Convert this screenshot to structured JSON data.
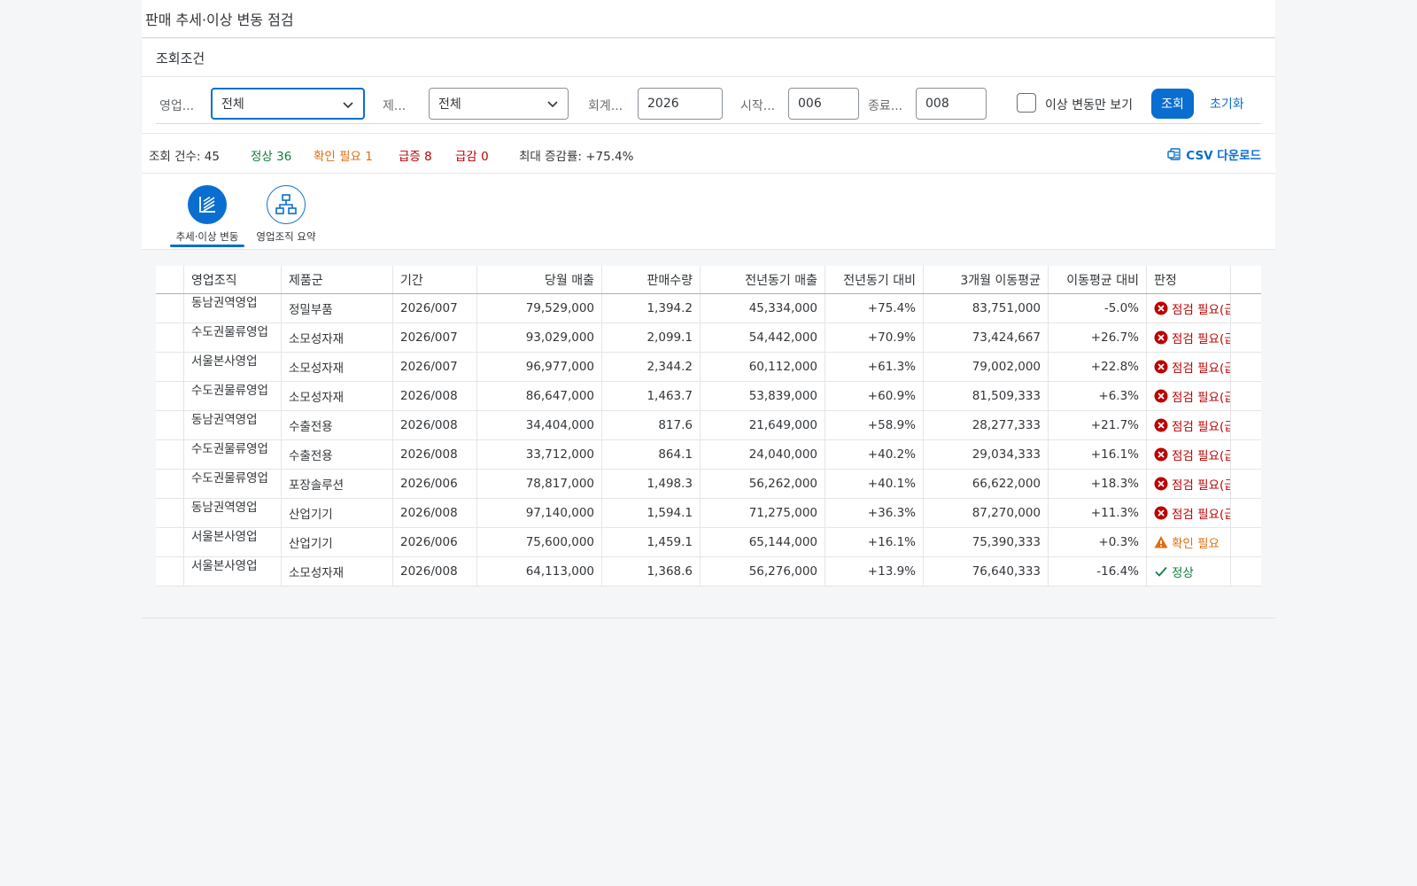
{
  "page": {
    "title": "판매 추세·이상 변동 점검"
  },
  "filterbar": {
    "title": "조회조건",
    "fields": [
      {
        "label": "영업...",
        "value": "전체",
        "type": "select"
      },
      {
        "label": "제...",
        "value": "전체",
        "type": "select"
      },
      {
        "label": "회계...",
        "value": "2026",
        "type": "input"
      },
      {
        "label": "시작...",
        "value": "006",
        "type": "input"
      },
      {
        "label": "종료...",
        "value": "008",
        "type": "input"
      }
    ],
    "anomaly_only_label": "이상 변동만 보기",
    "anomaly_only_checked": false,
    "search_label": "조회",
    "reset_label": "초기화"
  },
  "status": {
    "count": "조회 건수: 45",
    "normal": "정상 36",
    "check": "확인 필요 1",
    "surge": "급증 8",
    "drop": "급감 0",
    "max_rate": "최대 증감률: +75.4%",
    "csv_label": "CSV 다운로드"
  },
  "icon_tabs": [
    {
      "label": "추세·이상 변동",
      "icon": "trend-chart-icon",
      "selected": true
    },
    {
      "label": "영업조직 요약",
      "icon": "org-hierarchy-icon",
      "selected": false
    }
  ],
  "table": {
    "columns": [
      "영업조직",
      "제품군",
      "기간",
      "당월 매출",
      "판매수량",
      "전년동기 매출",
      "전년동기 대비",
      "3개월 이동평균",
      "이동평균 대비",
      "판정"
    ],
    "rows": [
      {
        "org": "동남권역영업",
        "product": "정밀부품",
        "period": "2026/007",
        "sales": "79,529,000",
        "qty": "1,394.2",
        "prev_sales": "45,334,000",
        "yoy": "+75.4%",
        "ma3": "83,751,000",
        "ma_diff": "-5.0%",
        "verdict": "점검 필요(급증)",
        "level": "bad"
      },
      {
        "org": "수도권물류영업",
        "product": "소모성자재",
        "period": "2026/007",
        "sales": "93,029,000",
        "qty": "2,099.1",
        "prev_sales": "54,442,000",
        "yoy": "+70.9%",
        "ma3": "73,424,667",
        "ma_diff": "+26.7%",
        "verdict": "점검 필요(급증)",
        "level": "bad"
      },
      {
        "org": "서울본사영업",
        "product": "소모성자재",
        "period": "2026/007",
        "sales": "96,977,000",
        "qty": "2,344.2",
        "prev_sales": "60,112,000",
        "yoy": "+61.3%",
        "ma3": "79,002,000",
        "ma_diff": "+22.8%",
        "verdict": "점검 필요(급증)",
        "level": "bad"
      },
      {
        "org": "수도권물류영업",
        "product": "소모성자재",
        "period": "2026/008",
        "sales": "86,647,000",
        "qty": "1,463.7",
        "prev_sales": "53,839,000",
        "yoy": "+60.9%",
        "ma3": "81,509,333",
        "ma_diff": "+6.3%",
        "verdict": "점검 필요(급증)",
        "level": "bad"
      },
      {
        "org": "동남권역영업",
        "product": "수출전용",
        "period": "2026/008",
        "sales": "34,404,000",
        "qty": "817.6",
        "prev_sales": "21,649,000",
        "yoy": "+58.9%",
        "ma3": "28,277,333",
        "ma_diff": "+21.7%",
        "verdict": "점검 필요(급증)",
        "level": "bad"
      },
      {
        "org": "수도권물류영업",
        "product": "수출전용",
        "period": "2026/008",
        "sales": "33,712,000",
        "qty": "864.1",
        "prev_sales": "24,040,000",
        "yoy": "+40.2%",
        "ma3": "29,034,333",
        "ma_diff": "+16.1%",
        "verdict": "점검 필요(급증)",
        "level": "bad"
      },
      {
        "org": "수도권물류영업",
        "product": "포장솔루션",
        "period": "2026/006",
        "sales": "78,817,000",
        "qty": "1,498.3",
        "prev_sales": "56,262,000",
        "yoy": "+40.1%",
        "ma3": "66,622,000",
        "ma_diff": "+18.3%",
        "verdict": "점검 필요(급증)",
        "level": "bad"
      },
      {
        "org": "동남권역영업",
        "product": "산업기기",
        "period": "2026/008",
        "sales": "97,140,000",
        "qty": "1,594.1",
        "prev_sales": "71,275,000",
        "yoy": "+36.3%",
        "ma3": "87,270,000",
        "ma_diff": "+11.3%",
        "verdict": "점검 필요(급증)",
        "level": "bad"
      },
      {
        "org": "서울본사영업",
        "product": "산업기기",
        "period": "2026/006",
        "sales": "75,600,000",
        "qty": "1,459.1",
        "prev_sales": "65,144,000",
        "yoy": "+16.1%",
        "ma3": "75,390,333",
        "ma_diff": "+0.3%",
        "verdict": "확인 필요",
        "level": "warn"
      },
      {
        "org": "서울본사영업",
        "product": "소모성자재",
        "period": "2026/008",
        "sales": "64,113,000",
        "qty": "1,368.6",
        "prev_sales": "56,276,000",
        "yoy": "+13.9%",
        "ma3": "76,640,333",
        "ma_diff": "-16.4%",
        "verdict": "정상",
        "level": "ok"
      }
    ]
  },
  "colors": {
    "accent": "#0a6ed1",
    "normal": "#107e3e",
    "warning": "#df6e0c",
    "error": "#bb0000"
  }
}
